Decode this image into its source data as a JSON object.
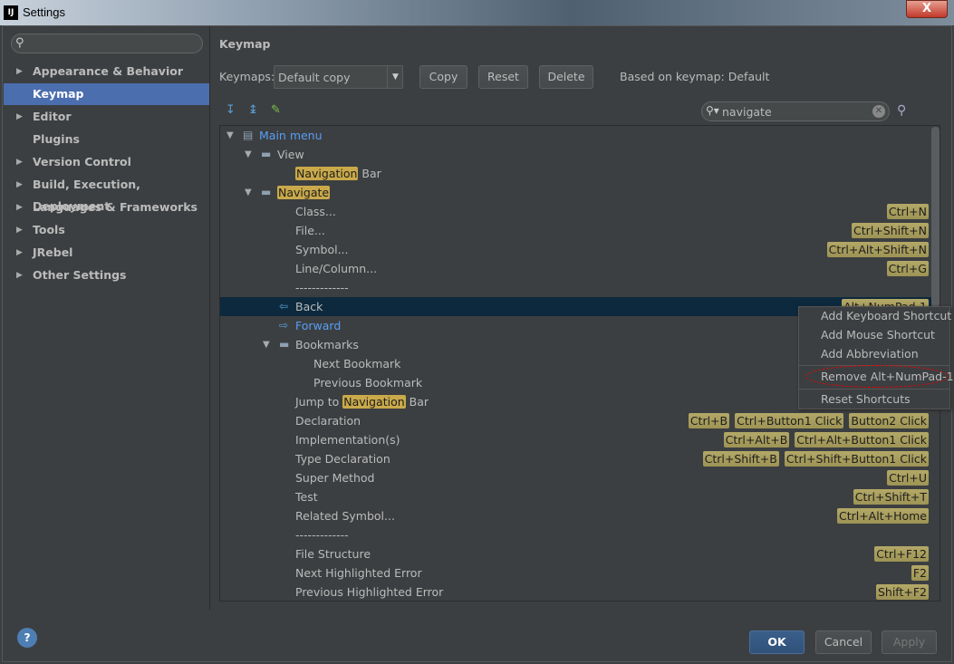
{
  "window": {
    "title": "Settings",
    "logo": "IJ",
    "close": "X"
  },
  "sidebar": {
    "search_placeholder": "",
    "items": [
      {
        "label": "Appearance & Behavior",
        "expandable": true
      },
      {
        "label": "Keymap",
        "expandable": false,
        "selected": true
      },
      {
        "label": "Editor",
        "expandable": true
      },
      {
        "label": "Plugins",
        "expandable": false
      },
      {
        "label": "Version Control",
        "expandable": true
      },
      {
        "label": "Build, Execution, Deployment",
        "expandable": true
      },
      {
        "label": "Languages & Frameworks",
        "expandable": true
      },
      {
        "label": "Tools",
        "expandable": true
      },
      {
        "label": "JRebel",
        "expandable": true
      },
      {
        "label": "Other Settings",
        "expandable": true
      }
    ]
  },
  "main": {
    "title": "Keymap",
    "keymaps_label": "Keymaps:",
    "keymap_value": "Default copy",
    "copy": "Copy",
    "reset": "Reset",
    "delete": "Delete",
    "based_on": "Based on keymap: Default",
    "search_value": "navigate"
  },
  "tree": [
    {
      "level": 0,
      "label": "Main menu",
      "arrow": "down",
      "icon": "menu",
      "color": "#589df6"
    },
    {
      "level": 1,
      "label": "View",
      "arrow": "down",
      "icon": "folder"
    },
    {
      "level": 2,
      "label": "Bar",
      "match": "Navigation",
      "match_pos": "start"
    },
    {
      "level": 1,
      "label": "",
      "match": "Navigate",
      "arrow": "down",
      "icon": "folder"
    },
    {
      "level": 2,
      "label": "Class...",
      "shortcuts": [
        "Ctrl+N"
      ]
    },
    {
      "level": 2,
      "label": "File...",
      "shortcuts": [
        "Ctrl+Shift+N"
      ]
    },
    {
      "level": 2,
      "label": "Symbol...",
      "shortcuts": [
        "Ctrl+Alt+Shift+N"
      ]
    },
    {
      "level": 2,
      "label": "Line/Column...",
      "shortcuts": [
        "Ctrl+G"
      ]
    },
    {
      "level": 2,
      "label": "-------------"
    },
    {
      "level": 2,
      "label": "Back",
      "icon": "back",
      "selected": true,
      "shortcuts": [
        "Alt+NumPad-1"
      ]
    },
    {
      "level": 2,
      "label": "Forward",
      "icon": "forward",
      "color": "#589df6"
    },
    {
      "level": 2,
      "label": "Bookmarks",
      "arrow": "down",
      "icon": "folder"
    },
    {
      "level": 3,
      "label": "Next Bookmark"
    },
    {
      "level": 3,
      "label": "Previous Bookmark"
    },
    {
      "level": 2,
      "label": "Jump to ",
      "match": "Navigation",
      "suffix": " Bar",
      "match_pos": "middle"
    },
    {
      "level": 2,
      "label": "Declaration",
      "shortcuts": [
        "Ctrl+B",
        "Ctrl+Button1 Click",
        "Button2 Click"
      ]
    },
    {
      "level": 2,
      "label": "Implementation(s)",
      "shortcuts": [
        "Ctrl+Alt+B",
        "Ctrl+Alt+Button1 Click"
      ]
    },
    {
      "level": 2,
      "label": "Type Declaration",
      "shortcuts": [
        "Ctrl+Shift+B",
        "Ctrl+Shift+Button1 Click"
      ]
    },
    {
      "level": 2,
      "label": "Super Method",
      "shortcuts": [
        "Ctrl+U"
      ]
    },
    {
      "level": 2,
      "label": "Test",
      "shortcuts": [
        "Ctrl+Shift+T"
      ]
    },
    {
      "level": 2,
      "label": "Related Symbol...",
      "shortcuts": [
        "Ctrl+Alt+Home"
      ]
    },
    {
      "level": 2,
      "label": "-------------"
    },
    {
      "level": 2,
      "label": "File Structure",
      "shortcuts": [
        "Ctrl+F12"
      ]
    },
    {
      "level": 2,
      "label": "Next Highlighted Error",
      "shortcuts": [
        "F2"
      ]
    },
    {
      "level": 2,
      "label": "Previous Highlighted Error",
      "shortcuts": [
        "Shift+F2"
      ]
    }
  ],
  "context_menu": {
    "items": [
      "Add Keyboard Shortcut",
      "Add Mouse Shortcut",
      "Add Abbreviation",
      "Remove Alt+NumPad-1",
      "Reset Shortcuts"
    ],
    "annotated_item": "Remove Alt+NumPad-1"
  },
  "footer": {
    "ok": "OK",
    "cancel": "Cancel",
    "apply": "Apply",
    "help": "?"
  },
  "colors": {
    "accent": "#4b6eaf",
    "selection": "#0d293e",
    "match_highlight": "#c9a94a",
    "shortcut_badge": "#a89e5d",
    "annotation": "#e00000"
  }
}
